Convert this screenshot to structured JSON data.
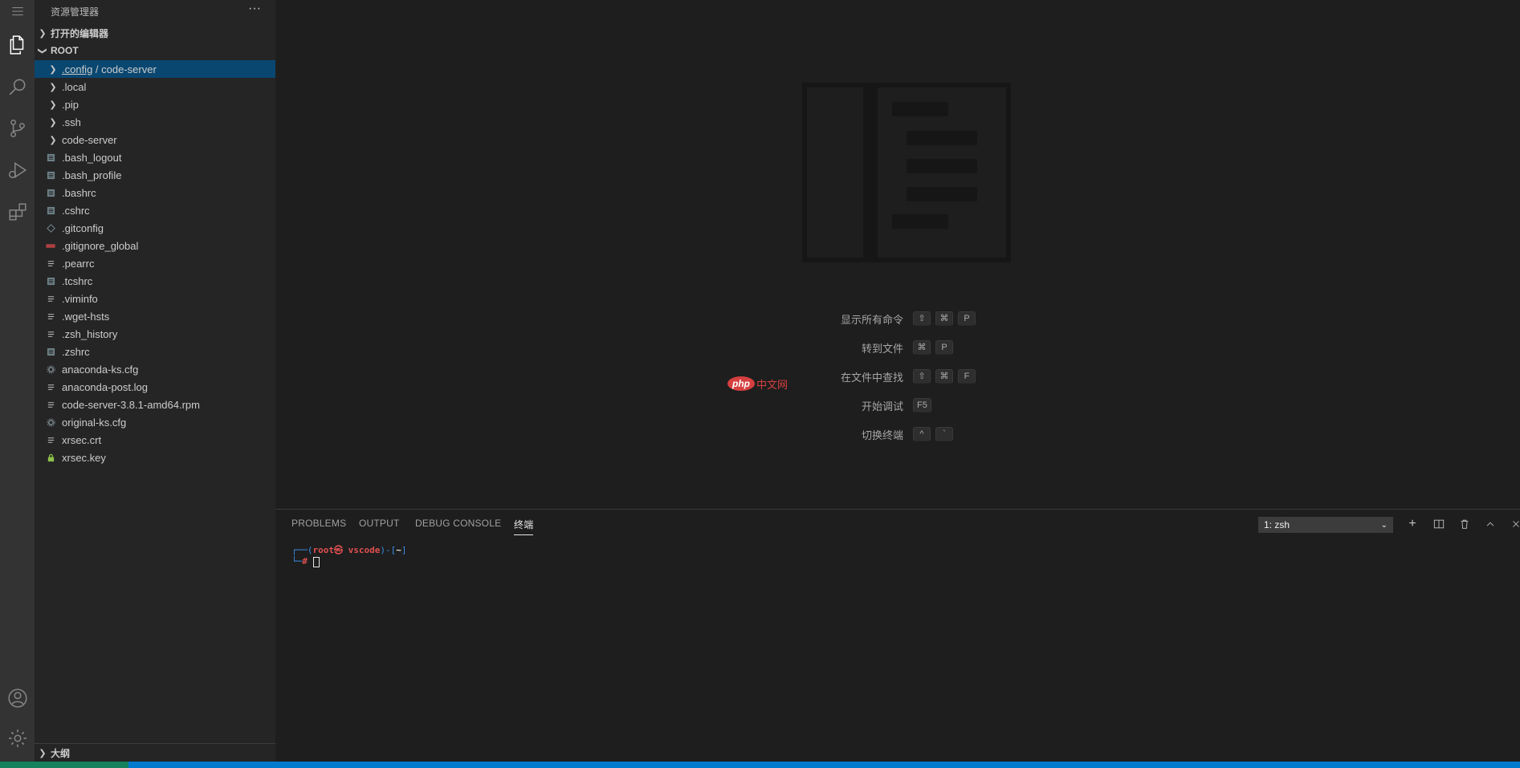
{
  "sidebar": {
    "title": "资源管理器",
    "more": "···",
    "open_editors": "打开的编辑器",
    "root": "ROOT",
    "outline": "大纲",
    "items": [
      {
        "prefix": ".config",
        "sep": " / ",
        "suffix": "code-server",
        "type": "folder"
      },
      {
        "label": ".local",
        "type": "folder"
      },
      {
        "label": ".pip",
        "type": "folder"
      },
      {
        "label": ".ssh",
        "type": "folder"
      },
      {
        "label": "code-server",
        "type": "folder"
      },
      {
        "label": ".bash_logout",
        "type": "file"
      },
      {
        "label": ".bash_profile",
        "type": "file"
      },
      {
        "label": ".bashrc",
        "type": "file"
      },
      {
        "label": ".cshrc",
        "type": "file"
      },
      {
        "label": ".gitconfig",
        "type": "git"
      },
      {
        "label": ".gitignore_global",
        "type": "gitignore"
      },
      {
        "label": ".pearrc",
        "type": "text"
      },
      {
        "label": ".tcshrc",
        "type": "file"
      },
      {
        "label": ".viminfo",
        "type": "text"
      },
      {
        "label": ".wget-hsts",
        "type": "text"
      },
      {
        "label": ".zsh_history",
        "type": "text"
      },
      {
        "label": ".zshrc",
        "type": "file"
      },
      {
        "label": "anaconda-ks.cfg",
        "type": "gear"
      },
      {
        "label": "anaconda-post.log",
        "type": "text"
      },
      {
        "label": "code-server-3.8.1-amd64.rpm",
        "type": "text"
      },
      {
        "label": "original-ks.cfg",
        "type": "gear"
      },
      {
        "label": "xrsec.crt",
        "type": "text"
      },
      {
        "label": "xrsec.key",
        "type": "lock"
      }
    ]
  },
  "welcome": {
    "shortcuts": [
      {
        "label": "显示所有命令",
        "keys": [
          "⇧",
          "⌘",
          "P"
        ]
      },
      {
        "label": "转到文件",
        "keys": [
          "⌘",
          "P"
        ]
      },
      {
        "label": "在文件中查找",
        "keys": [
          "⇧",
          "⌘",
          "F"
        ]
      },
      {
        "label": "开始调试",
        "keys": [
          "F5"
        ]
      },
      {
        "label": "切换终端",
        "keys": [
          "^",
          "`"
        ]
      }
    ],
    "watermark": {
      "logo": "php",
      "text": "中文网"
    }
  },
  "panel": {
    "tabs": [
      "PROBLEMS",
      "OUTPUT",
      "DEBUG CONSOLE",
      "终端"
    ],
    "active_tab": "终端",
    "terminal_select": "1: zsh",
    "terminal": {
      "line1_prefix": "┌──(",
      "user": "root㉿",
      "host": " vscode",
      "line1_mid": ")-[",
      "path": "~",
      "line1_end": "]",
      "line2_prefix": "└─",
      "prompt": "#"
    }
  },
  "colors": {
    "activity_bar": "#333333",
    "sidebar": "#252526",
    "editor": "#1e1e1e",
    "selection": "#094771",
    "statusbar": "#007acc",
    "terminal_red": "#e05050",
    "terminal_blue": "#3b8eea"
  }
}
